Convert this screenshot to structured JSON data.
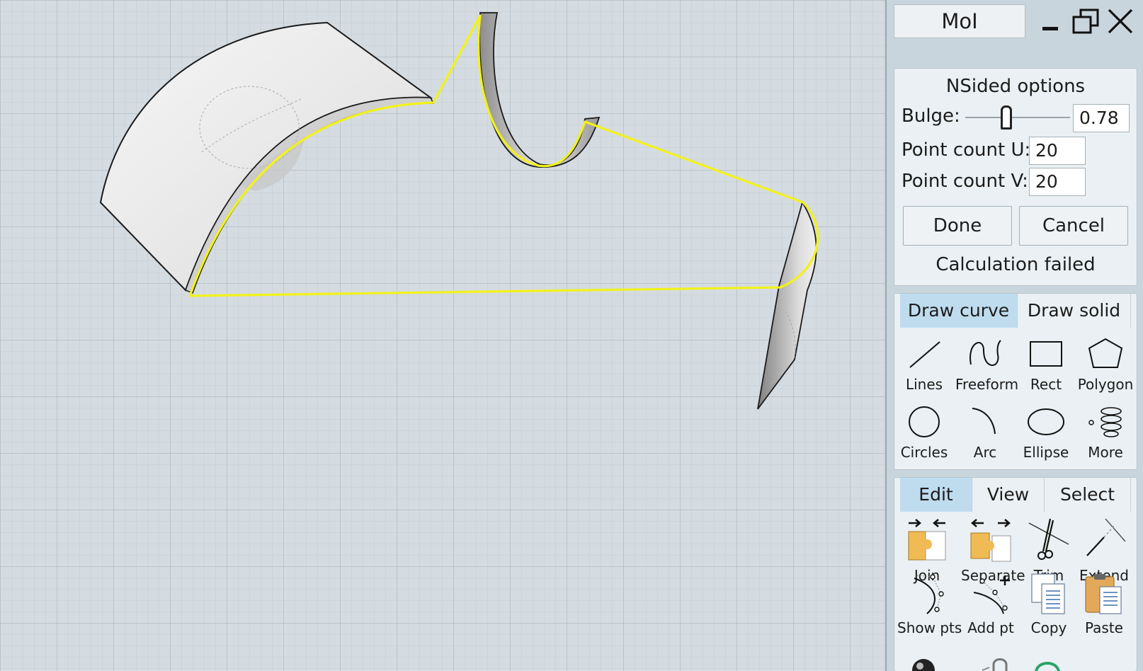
{
  "app": {
    "title": "MoI"
  },
  "window_controls": {
    "minimize": "minimize-icon",
    "maximize": "restore-icon",
    "close": "close-icon"
  },
  "options": {
    "title": "NSided options",
    "bulge_label": "Bulge:",
    "bulge_value": "0.78",
    "bulge_slider_fraction": 0.39,
    "point_u_label": "Point count U:",
    "point_u_value": "20",
    "point_v_label": "Point count V:",
    "point_v_value": "20",
    "done_label": "Done",
    "cancel_label": "Cancel",
    "status": "Calculation failed"
  },
  "draw_tabs": [
    {
      "label": "Draw curve",
      "active": true
    },
    {
      "label": "Draw solid",
      "active": false
    }
  ],
  "draw_tools": [
    {
      "label": "Lines",
      "icon": "line-icon"
    },
    {
      "label": "Freeform",
      "icon": "freeform-icon"
    },
    {
      "label": "Rect",
      "icon": "rectangle-icon"
    },
    {
      "label": "Polygon",
      "icon": "polygon-icon"
    },
    {
      "label": "Circles",
      "icon": "circle-icon"
    },
    {
      "label": "Arc",
      "icon": "arc-icon"
    },
    {
      "label": "Ellipse",
      "icon": "ellipse-icon"
    },
    {
      "label": "More",
      "icon": "helix-icon"
    }
  ],
  "edit_tabs": [
    {
      "label": "Edit",
      "active": true
    },
    {
      "label": "View",
      "active": false
    },
    {
      "label": "Select",
      "active": false
    }
  ],
  "edit_tools": [
    {
      "label": "Join",
      "icon": "join-icon"
    },
    {
      "label": "Separate",
      "icon": "separate-icon"
    },
    {
      "label": "Trim",
      "icon": "scissors-icon"
    },
    {
      "label": "Extend",
      "icon": "extend-icon"
    },
    {
      "label": "Show pts",
      "icon": "show-points-icon"
    },
    {
      "label": "Add pt",
      "icon": "add-point-icon"
    },
    {
      "label": "Copy",
      "icon": "copy-icon"
    },
    {
      "label": "Paste",
      "icon": "paste-icon"
    }
  ],
  "colors": {
    "selection": "#f2f21a",
    "active_tab": "#bfdcef",
    "panel_bg": "#c9d5dc"
  }
}
